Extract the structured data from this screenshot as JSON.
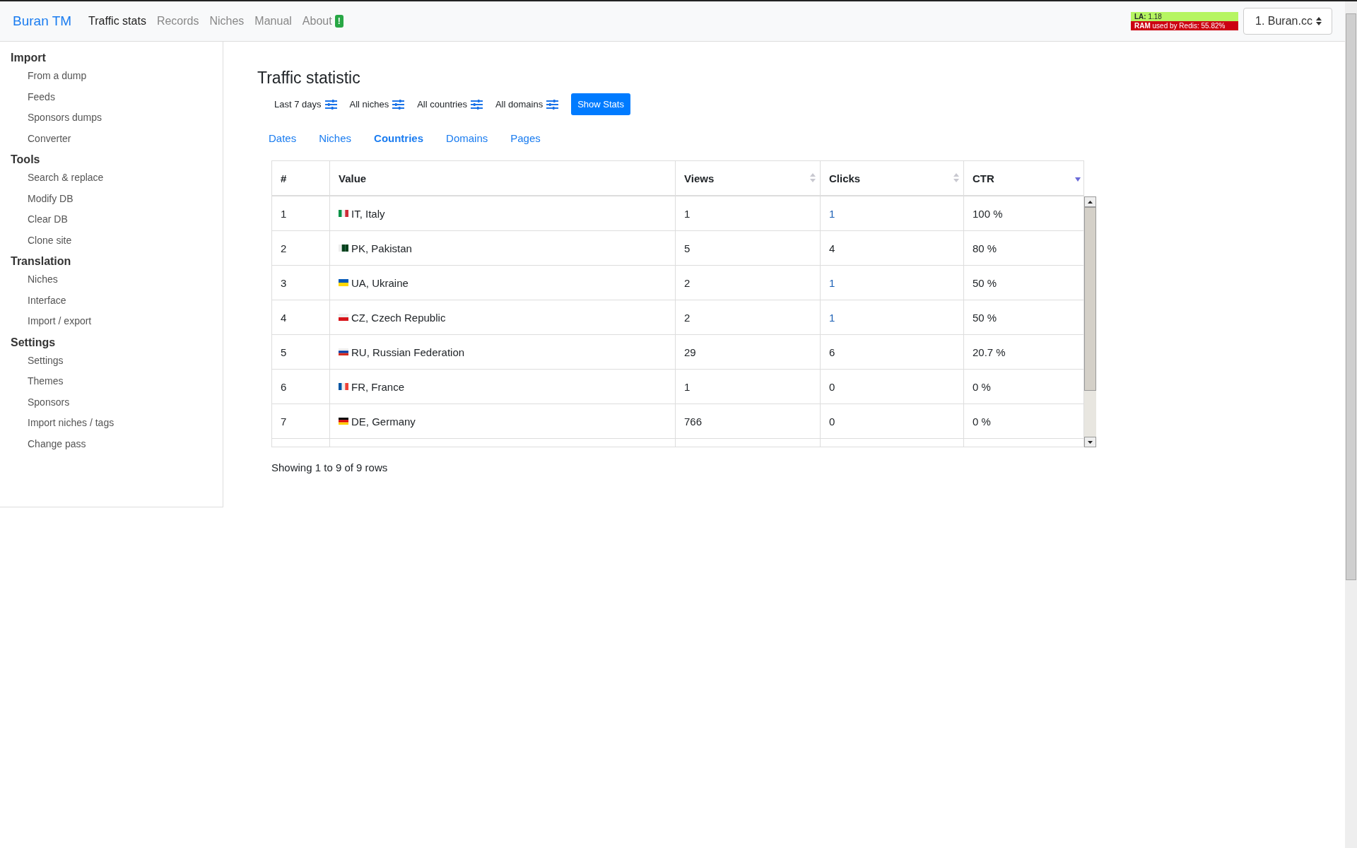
{
  "navbar": {
    "brand": "Buran TM",
    "items": [
      {
        "label": "Traffic stats",
        "selected": true
      },
      {
        "label": "Records",
        "selected": false
      },
      {
        "label": "Niches",
        "selected": false
      },
      {
        "label": "Manual",
        "selected": false
      },
      {
        "label": "About",
        "selected": false,
        "badge": "!"
      }
    ],
    "load": {
      "label": "LA:",
      "value": "1.18"
    },
    "ram": {
      "label": "RAM",
      "text": "used by Redis: 55.82%"
    },
    "site_select": {
      "value": "1. Buran.cc"
    }
  },
  "sidebar": {
    "groups": [
      {
        "title": "Import",
        "items": [
          "From a dump",
          "Feeds",
          "Sponsors dumps",
          "Converter"
        ]
      },
      {
        "title": "Tools",
        "items": [
          "Search & replace",
          "Modify DB",
          "Clear DB",
          "Clone site"
        ]
      },
      {
        "title": "Translation",
        "items": [
          "Niches",
          "Interface",
          "Import / export"
        ]
      },
      {
        "title": "Settings",
        "items": [
          "Settings",
          "Themes",
          "Sponsors",
          "Import niches / tags",
          "Change pass"
        ]
      }
    ]
  },
  "page_title": "Traffic statistic",
  "filters": [
    "Last 7 days",
    "All niches",
    "All countries",
    "All domains"
  ],
  "show_button": "Show Stats",
  "tabs": [
    {
      "label": "Dates",
      "selected": false
    },
    {
      "label": "Niches",
      "selected": false
    },
    {
      "label": "Countries",
      "selected": true
    },
    {
      "label": "Domains",
      "selected": false
    },
    {
      "label": "Pages",
      "selected": false
    }
  ],
  "table": {
    "columns": [
      {
        "label": "#"
      },
      {
        "label": "Value"
      },
      {
        "label": "Views",
        "sorted": false
      },
      {
        "label": "Clicks",
        "sorted": false
      },
      {
        "label": "CTR",
        "sorted": true
      }
    ],
    "rows": [
      {
        "n": "1",
        "flag": {
          "kind": "vertical",
          "stripes": [
            {
              "color": "#009246"
            },
            {
              "color": "#eeeeee"
            },
            {
              "color": "#ce2b37"
            }
          ]
        },
        "value": "IT, Italy",
        "views": "1",
        "clicks": "1",
        "clicks_link": true,
        "ctr": "100 %"
      },
      {
        "n": "2",
        "flag": {
          "kind": "vertical",
          "stripes": [
            {
              "color": "#eeeeee"
            },
            {
              "color": "#01411c"
            },
            {
              "color": "#01411c"
            }
          ]
        },
        "value": "PK, Pakistan",
        "views": "5",
        "clicks": "4",
        "clicks_link": false,
        "ctr": "80 %"
      },
      {
        "n": "3",
        "flag": {
          "kind": "horizontal",
          "stripes": [
            {
              "color": "#0057b7"
            },
            {
              "color": "#ffd700"
            }
          ]
        },
        "value": "UA, Ukraine",
        "views": "2",
        "clicks": "1",
        "clicks_link": true,
        "ctr": "50 %"
      },
      {
        "n": "4",
        "flag": {
          "kind": "horizontal",
          "stripes": [
            {
              "color": "#eeeeee"
            },
            {
              "color": "#d7141a"
            }
          ]
        },
        "value": "CZ, Czech Republic",
        "views": "2",
        "clicks": "1",
        "clicks_link": true,
        "ctr": "50 %"
      },
      {
        "n": "5",
        "flag": {
          "kind": "horizontal",
          "stripes": [
            {
              "color": "#eeeeee"
            },
            {
              "color": "#0039a6"
            },
            {
              "color": "#d52b1e"
            }
          ]
        },
        "value": "RU, Russian Federation",
        "views": "29",
        "clicks": "6",
        "clicks_link": false,
        "ctr": "20.7 %"
      },
      {
        "n": "6",
        "flag": {
          "kind": "vertical",
          "stripes": [
            {
              "color": "#0055a4"
            },
            {
              "color": "#eeeeee"
            },
            {
              "color": "#ef4135"
            }
          ]
        },
        "value": "FR, France",
        "views": "1",
        "clicks": "0",
        "clicks_link": false,
        "ctr": "0 %"
      },
      {
        "n": "7",
        "flag": {
          "kind": "horizontal",
          "stripes": [
            {
              "color": "#000000"
            },
            {
              "color": "#dd0000"
            },
            {
              "color": "#ffce00"
            }
          ]
        },
        "value": "DE, Germany",
        "views": "766",
        "clicks": "0",
        "clicks_link": false,
        "ctr": "0 %"
      }
    ]
  },
  "pagination_info": "Showing 1 to 9 of 9 rows"
}
